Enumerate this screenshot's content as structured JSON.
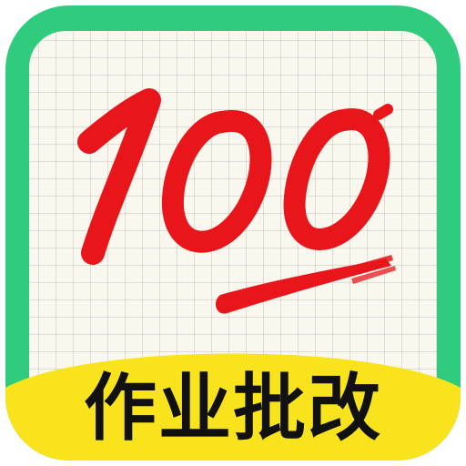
{
  "score": {
    "text": "100"
  },
  "banner": {
    "text": "作业批改"
  },
  "colors": {
    "frame": "#2fcc7e",
    "paper": "#faf8ee",
    "score": "#e8161b",
    "banner": "#f8e31c",
    "banner_text": "#111111"
  }
}
